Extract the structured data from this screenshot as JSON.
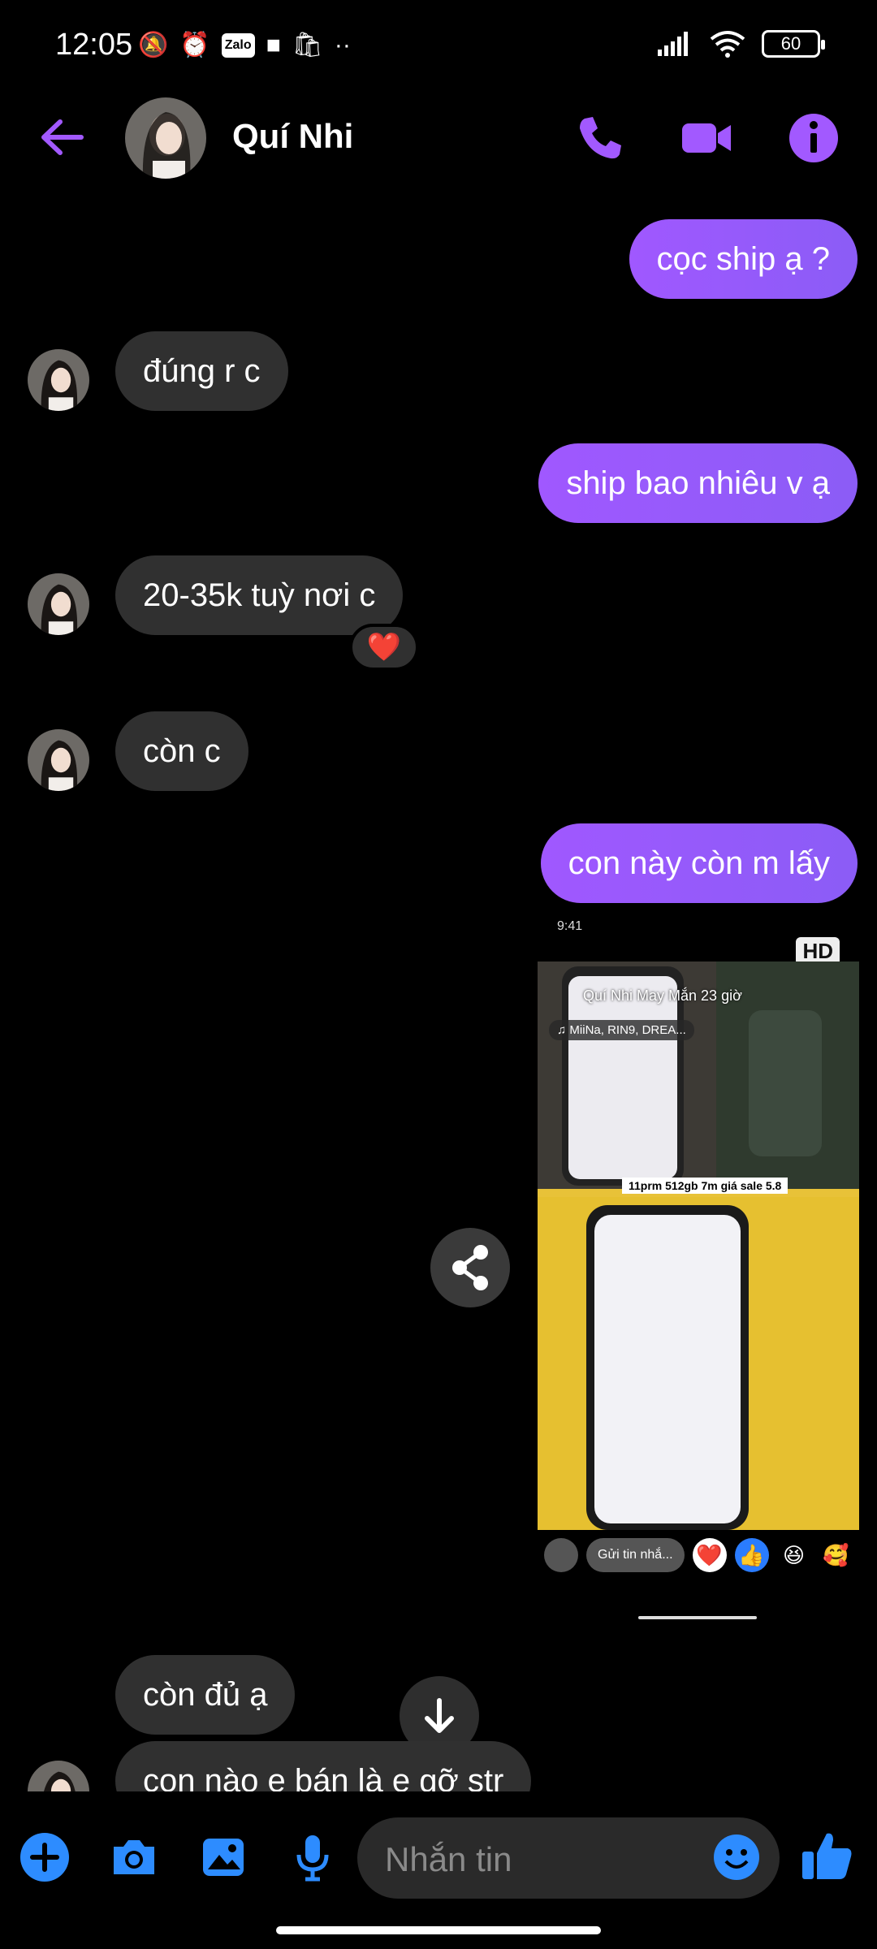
{
  "status_bar": {
    "time": "12:05",
    "left_icons": [
      "muted-bell-icon",
      "alarm-icon",
      "zalo-icon",
      "video-camera-icon",
      "shopee-icon",
      "more-dots-icon"
    ],
    "zalo_label": "Zalo",
    "battery": "60"
  },
  "header": {
    "contact_name": "Quí Nhi"
  },
  "messages": [
    {
      "direction": "outgoing",
      "text": "cọc ship ạ ?"
    },
    {
      "direction": "incoming",
      "text": "đúng r c"
    },
    {
      "direction": "outgoing",
      "text": "ship bao nhiêu v ạ"
    },
    {
      "direction": "incoming",
      "text": "20-35k tuỳ nơi c",
      "reaction": "❤️"
    },
    {
      "direction": "incoming",
      "text": "còn c"
    },
    {
      "direction": "outgoing",
      "text": "con này còn m lấy"
    },
    {
      "direction": "incoming",
      "text": "còn đủ ạ"
    },
    {
      "direction": "incoming",
      "text": "con nào e bán là e gỡ str"
    }
  ],
  "shared_post": {
    "status_time": "9:41",
    "hd_label": "HD",
    "author_line": "Quí Nhi May Mắn 23 giờ",
    "music": "♫ MiiNa, RIN9, DREA...",
    "caption": "11prm 512gb 7m giá sale 5.8",
    "reply_label": "Gửi tin nhắ...",
    "reactions": [
      "❤️",
      "👍",
      "😆",
      "🥰"
    ]
  },
  "composer": {
    "placeholder": "Nhắn tin"
  },
  "colors": {
    "accent": "#9b4dff",
    "incoming_bubble": "#303030",
    "background": "#000000"
  }
}
